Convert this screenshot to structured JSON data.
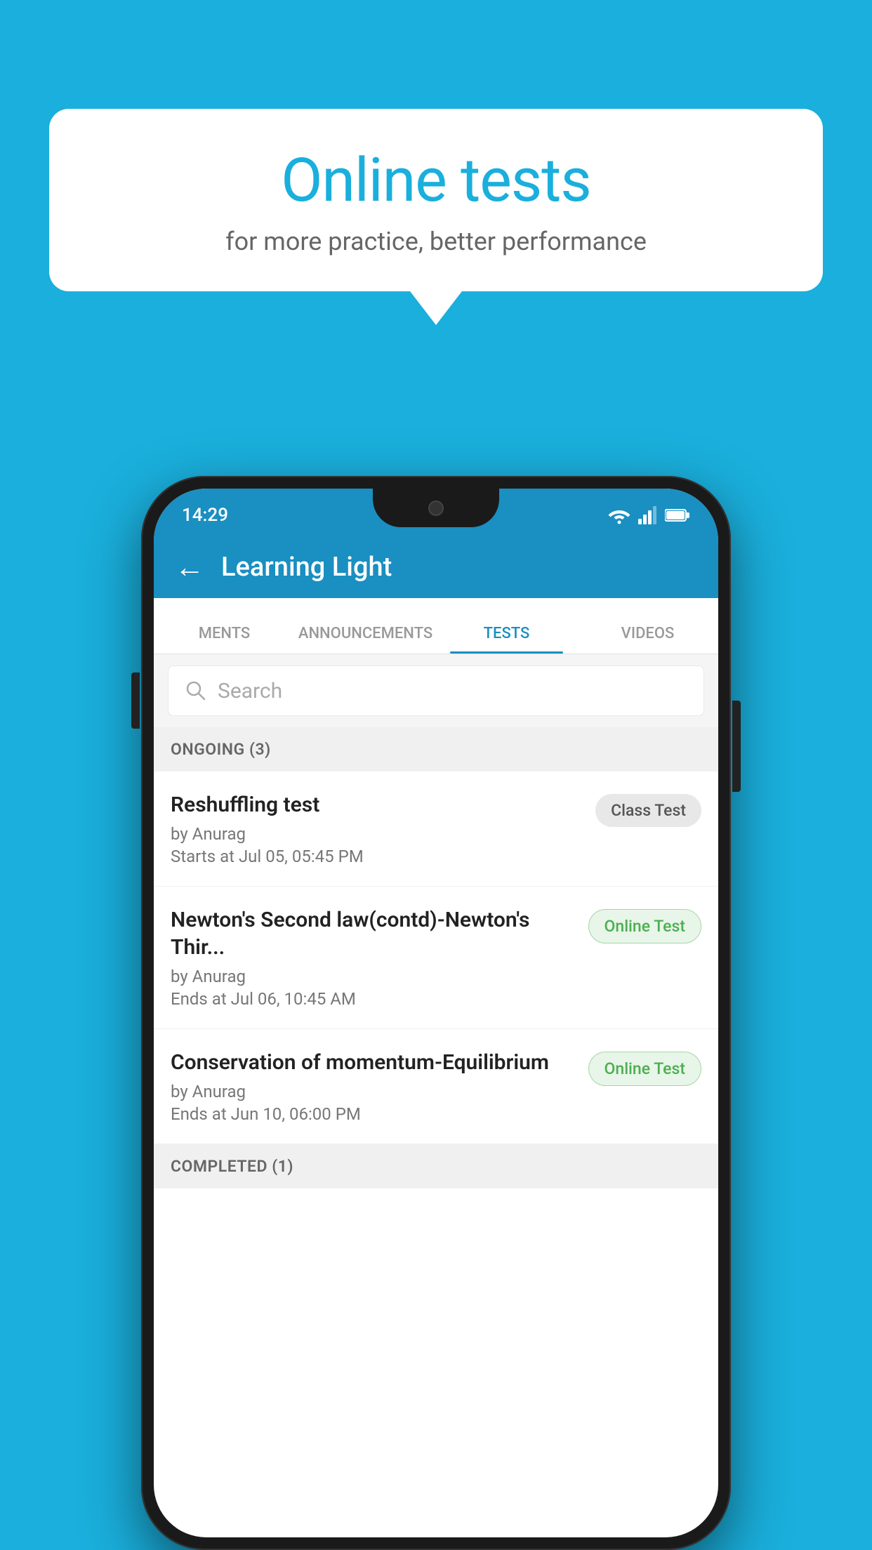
{
  "background_color": "#1AAFDC",
  "bubble": {
    "title": "Online tests",
    "subtitle": "for more practice, better performance"
  },
  "phone": {
    "status_bar": {
      "time": "14:29"
    },
    "header": {
      "title": "Learning Light",
      "back_label": "←"
    },
    "tabs": [
      {
        "label": "MENTS",
        "active": false
      },
      {
        "label": "ANNOUNCEMENTS",
        "active": false
      },
      {
        "label": "TESTS",
        "active": true
      },
      {
        "label": "VIDEOS",
        "active": false
      }
    ],
    "search": {
      "placeholder": "Search"
    },
    "ongoing_section": {
      "label": "ONGOING (3)"
    },
    "test_items": [
      {
        "name": "Reshuffling test",
        "author": "by Anurag",
        "time_label": "Starts at",
        "time": "Jul 05, 05:45 PM",
        "badge": "Class Test",
        "badge_type": "class"
      },
      {
        "name": "Newton's Second law(contd)-Newton's Thir...",
        "author": "by Anurag",
        "time_label": "Ends at",
        "time": "Jul 06, 10:45 AM",
        "badge": "Online Test",
        "badge_type": "online"
      },
      {
        "name": "Conservation of momentum-Equilibrium",
        "author": "by Anurag",
        "time_label": "Ends at",
        "time": "Jun 10, 06:00 PM",
        "badge": "Online Test",
        "badge_type": "online"
      }
    ],
    "completed_section": {
      "label": "COMPLETED (1)"
    }
  }
}
